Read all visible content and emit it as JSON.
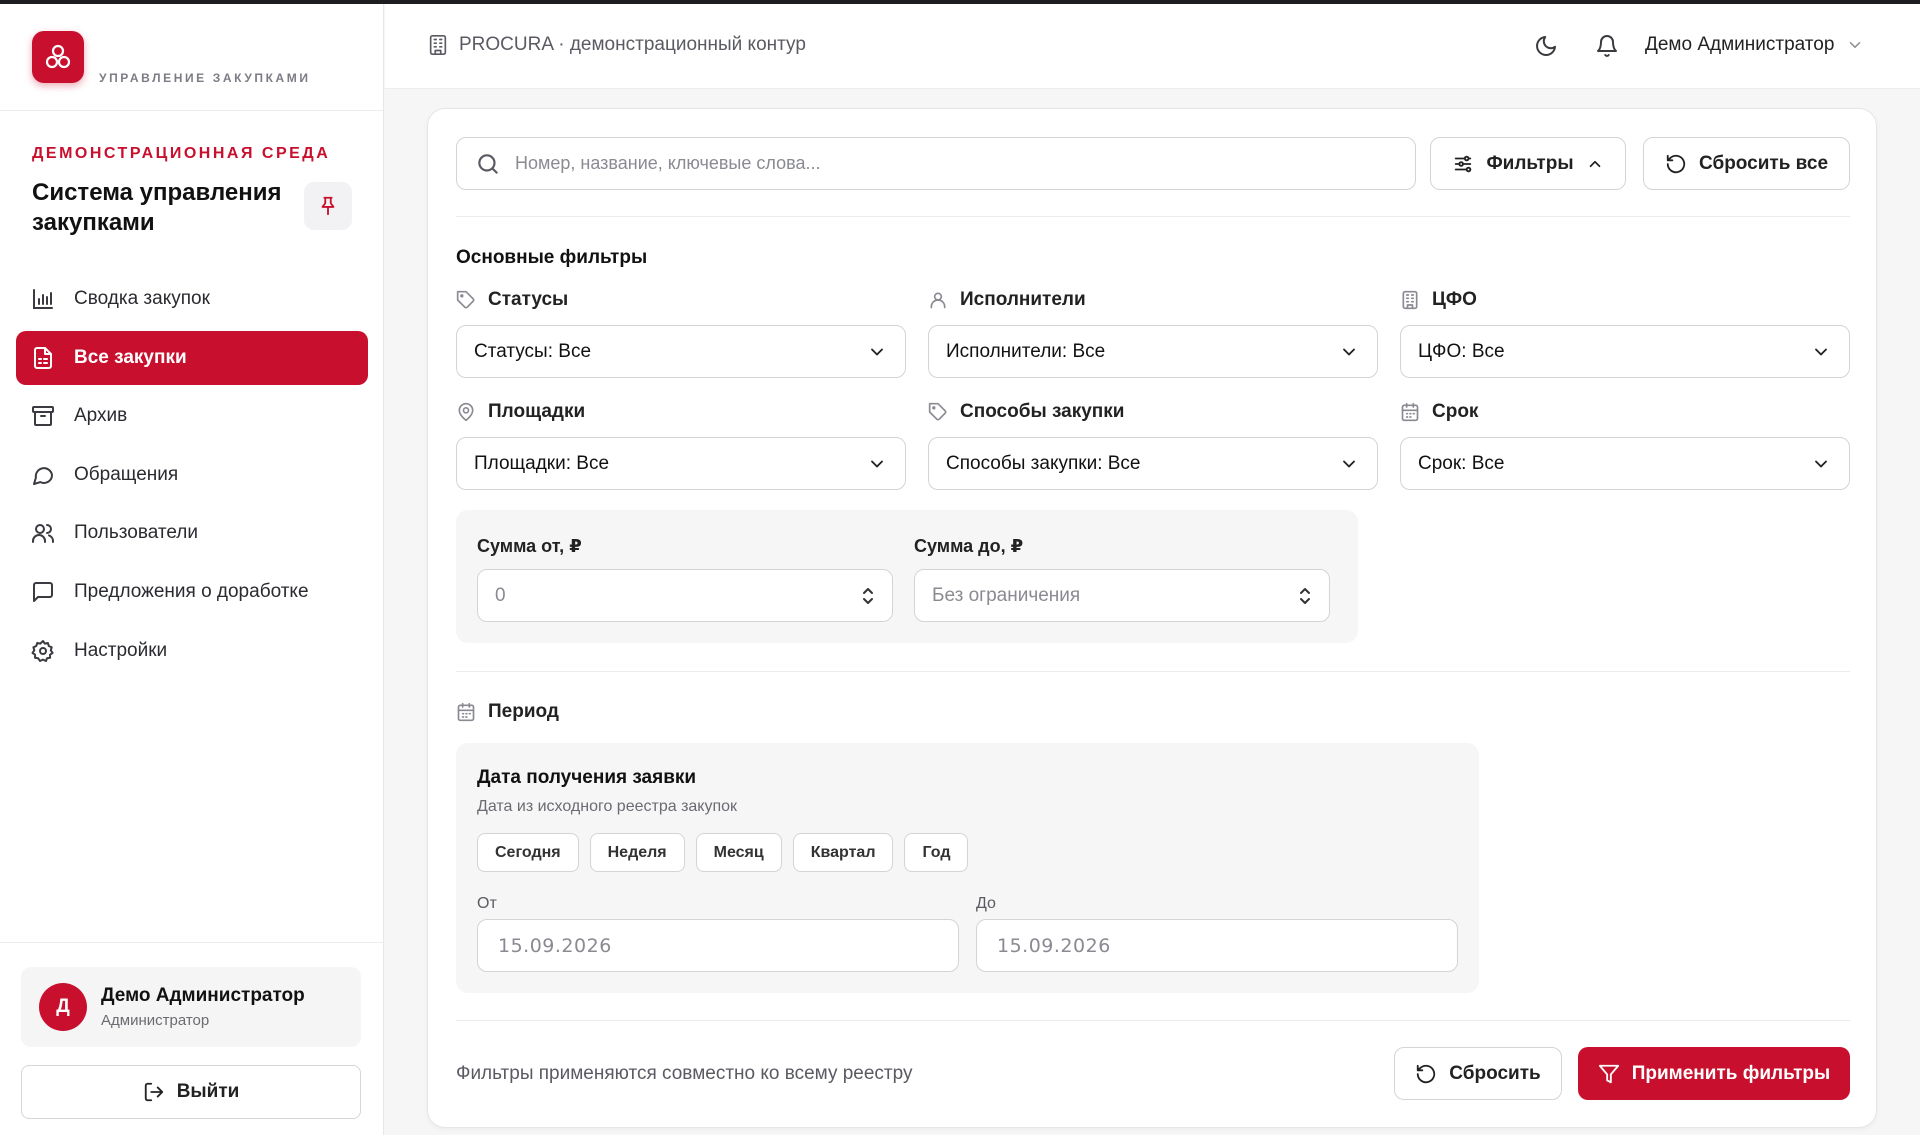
{
  "brand": {
    "subtitle": "УПРАВЛЕНИЕ ЗАКУПКАМИ",
    "environment": "ДЕМОНСТРАЦИОННАЯ СРЕДА",
    "system_title": "Система управления закупками",
    "accent": "#c8102e"
  },
  "sidebar": {
    "items": [
      {
        "label": "Сводка закупок",
        "icon": "bar-chart-icon"
      },
      {
        "label": "Все закупки",
        "icon": "document-list-icon",
        "active": true
      },
      {
        "label": "Архив",
        "icon": "archive-icon"
      },
      {
        "label": "Обращения",
        "icon": "chat-bubble-icon"
      },
      {
        "label": "Пользователи",
        "icon": "users-icon"
      },
      {
        "label": "Предложения о доработке",
        "icon": "message-square-icon"
      },
      {
        "label": "Настройки",
        "icon": "gear-icon"
      }
    ],
    "user": {
      "initial": "Д",
      "name": "Демо Администратор",
      "role": "Администратор"
    },
    "logout_label": "Выйти"
  },
  "header": {
    "breadcrumb": "PROCURA · демонстрационный контур",
    "user_name": "Демо Администратор"
  },
  "search": {
    "placeholder": "Номер, название, ключевые слова..."
  },
  "toolbar": {
    "filters_label": "Фильтры",
    "reset_all_label": "Сбросить все"
  },
  "filters": {
    "section_title": "Основные фильтры",
    "fields": [
      {
        "label": "Статусы",
        "value": "Статусы: Все",
        "icon": "tag-icon"
      },
      {
        "label": "Исполнители",
        "value": "Исполнители: Все",
        "icon": "user-icon"
      },
      {
        "label": "ЦФО",
        "value": "ЦФО: Все",
        "icon": "building-icon"
      },
      {
        "label": "Площадки",
        "value": "Площадки: Все",
        "icon": "map-pin-icon"
      },
      {
        "label": "Способы закупки",
        "value": "Способы закупки: Все",
        "icon": "tag-icon"
      },
      {
        "label": "Срок",
        "value": "Срок: Все",
        "icon": "calendar-icon"
      }
    ],
    "amount_from": {
      "label": "Сумма от, ₽",
      "placeholder": "0"
    },
    "amount_to": {
      "label": "Сумма до, ₽",
      "placeholder": "Без ограничения"
    }
  },
  "period": {
    "section_title": "Период",
    "title": "Дата получения заявки",
    "subtitle": "Дата из исходного реестра закупок",
    "chips": [
      "Сегодня",
      "Неделя",
      "Месяц",
      "Квартал",
      "Год"
    ],
    "from_label": "От",
    "to_label": "До",
    "from_value": "15.09.2026",
    "to_value": "15.09.2026"
  },
  "footer": {
    "note": "Фильтры применяются совместно ко всему реестру",
    "reset_label": "Сбросить",
    "apply_label": "Применить фильтры"
  }
}
